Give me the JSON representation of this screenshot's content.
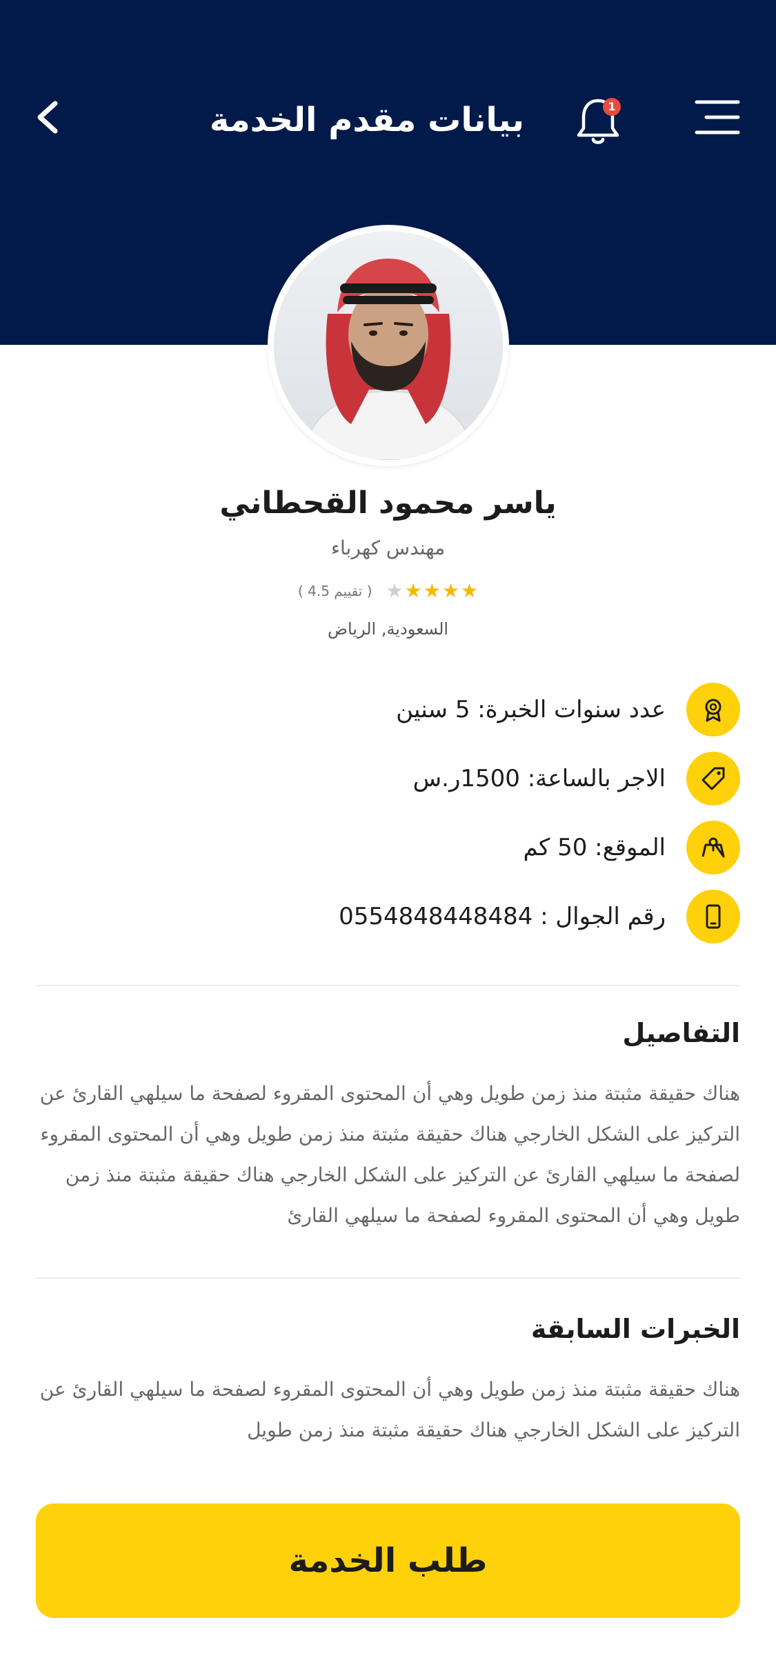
{
  "header": {
    "title": "بيانات مقدم الخدمة",
    "notification_count": "1",
    "background": "#021A4A"
  },
  "profile": {
    "name": "ياسر محمود القحطاني",
    "job": "مهندس كهرباء",
    "rating_value": 4.5,
    "rating_text": "( تقييم 4.5 )",
    "location": "السعودية, الرياض"
  },
  "info": [
    {
      "icon": "award-icon",
      "text": "عدد سنوات الخبرة: 5 سنين"
    },
    {
      "icon": "price-tag-icon",
      "text": "الاجر بالساعة: 1500ر.س"
    },
    {
      "icon": "map-icon",
      "text": "الموقع: 50 كم"
    },
    {
      "icon": "phone-icon",
      "text": "رقم الجوال : 0554848448484"
    }
  ],
  "details": {
    "title": "التفاصيل",
    "body": "هناك حقيقة مثبتة منذ زمن طويل وهي أن المحتوى المقروء لصفحة ما سيلهي القارئ عن التركيز على الشكل الخارجي هناك حقيقة مثبتة منذ زمن طويل وهي أن المحتوى المقروء لصفحة ما سيلهي القارئ عن التركيز على الشكل الخارجي هناك حقيقة مثبتة منذ زمن طويل وهي أن المحتوى المقروء لصفحة ما سيلهي القارئ"
  },
  "experience": {
    "title": "الخبرات السابقة",
    "body": "هناك حقيقة مثبتة منذ زمن طويل وهي أن المحتوى المقروء لصفحة ما سيلهي القارئ عن التركيز على الشكل الخارجي هناك حقيقة مثبتة منذ زمن طويل"
  },
  "cta": {
    "label": "طلب الخدمة"
  },
  "colors": {
    "accent": "#FFD10A",
    "navy": "#021A4A",
    "star": "#F6B800"
  }
}
